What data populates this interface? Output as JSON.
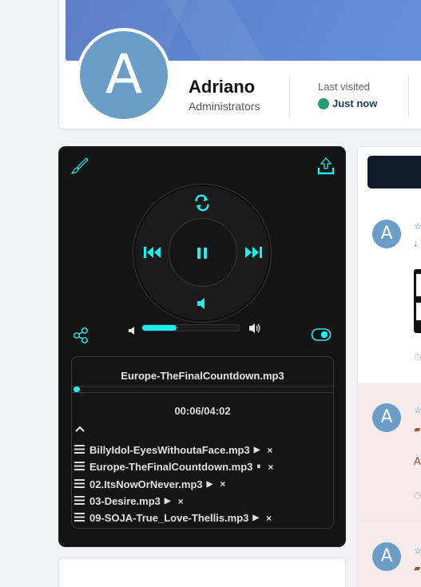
{
  "profile": {
    "avatar_letter": "A",
    "name": "Adriano",
    "role": "Administrators",
    "last_visited_label": "Last visited",
    "last_visited_value": "Just now",
    "status_color": "#2a9d6f"
  },
  "player": {
    "accent_color": "#19f0f3",
    "current_track": "Europe-TheFinalCountdown.mp3",
    "time": "00:06/04:02",
    "progress": 0.025,
    "volume": 0.35,
    "is_playing": true,
    "icons": [
      "paint-brush-icon",
      "upload-icon",
      "repeat-icon",
      "previous-icon",
      "pause-icon",
      "next-icon",
      "volume-icon",
      "share-icon",
      "toggle-icon",
      "collapse-icon"
    ],
    "playlist": [
      {
        "name": "BillyIdol-EyesWithoutaFace.mp3",
        "state": "▶",
        "remove": "×"
      },
      {
        "name": "Europe-TheFinalCountdown.mp3",
        "state": "⏸",
        "remove": "×"
      },
      {
        "name": "02.ItsNowOrNever.mp3",
        "state": "▶",
        "remove": "×"
      },
      {
        "name": "03-Desire.mp3",
        "state": "▶",
        "remove": "×"
      },
      {
        "name": "09-SOJA-True_Love-Thellis.mp3",
        "state": "▶",
        "remove": "×"
      }
    ]
  },
  "feed": {
    "avatar_letter": "A",
    "item2_text": "A"
  }
}
